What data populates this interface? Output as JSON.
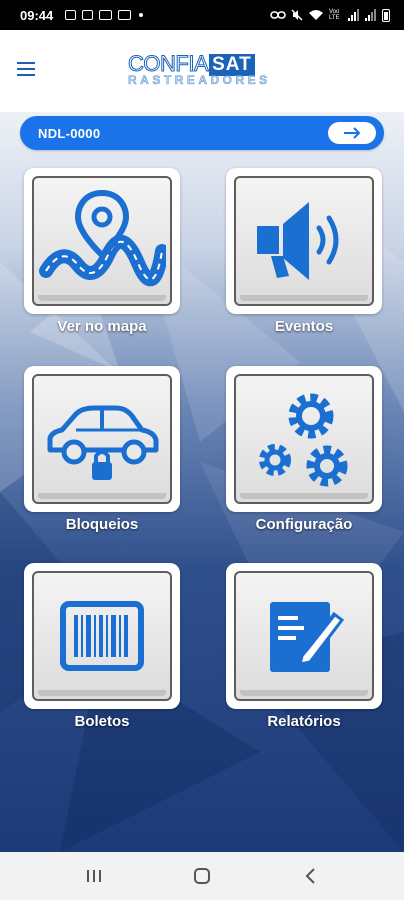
{
  "status_bar": {
    "time": "09:44",
    "icons_left": [
      "image-icon",
      "email-icon",
      "monitor-icon",
      "laptop-icon",
      "dot-icon"
    ],
    "icons_right": [
      "link-icon",
      "mute-icon",
      "wifi-icon",
      "signal-icon",
      "signal-icon",
      "battery-icon"
    ],
    "wifi_label": "Voo LTE"
  },
  "header": {
    "logo_top_left": "CONFIA",
    "logo_top_right": "SAT",
    "logo_bottom": "RASTREADORES",
    "brand_color": "#1a63b8"
  },
  "vehicle_selector": {
    "plate": "NDL-0000",
    "accent": "#1a73e8"
  },
  "tiles": [
    {
      "label": "Ver no mapa",
      "icon": "map-pin-road-icon"
    },
    {
      "label": "Eventos",
      "icon": "speaker-icon"
    },
    {
      "label": "Bloqueios",
      "icon": "car-lock-icon"
    },
    {
      "label": "Configuração",
      "icon": "gears-icon"
    },
    {
      "label": "Boletos",
      "icon": "barcode-icon"
    },
    {
      "label": "Relatórios",
      "icon": "report-pen-icon"
    }
  ],
  "nav_bar": {
    "buttons": [
      "recent-apps-icon",
      "home-icon",
      "back-icon"
    ]
  }
}
